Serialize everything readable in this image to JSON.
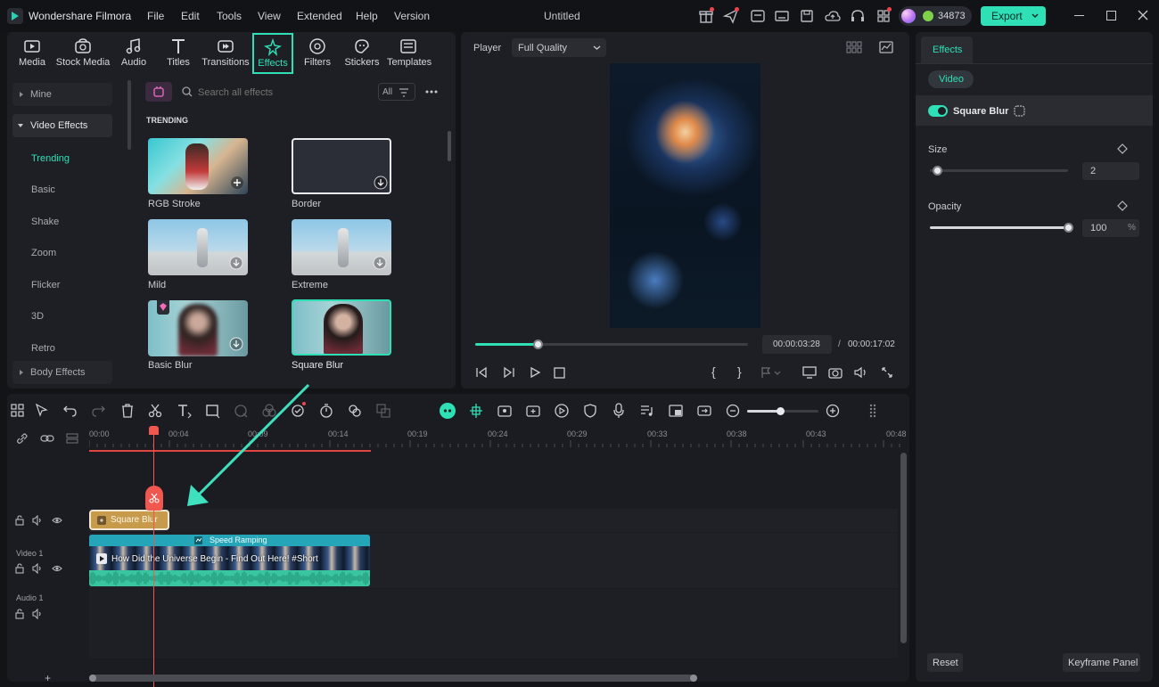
{
  "app": {
    "name": "Wondershare Filmora",
    "menu": [
      "File",
      "Edit",
      "Tools",
      "View",
      "Extended",
      "Help",
      "Version"
    ],
    "doc_title": "Untitled",
    "credits": "34873",
    "export_label": "Export"
  },
  "toolbar": {
    "tabs": [
      {
        "label": "Media",
        "icon": "media-icon"
      },
      {
        "label": "Stock Media",
        "icon": "stock-media-icon"
      },
      {
        "label": "Audio",
        "icon": "audio-icon"
      },
      {
        "label": "Titles",
        "icon": "titles-icon"
      },
      {
        "label": "Transitions",
        "icon": "transitions-icon"
      },
      {
        "label": "Effects",
        "icon": "effects-icon"
      },
      {
        "label": "Filters",
        "icon": "filters-icon"
      },
      {
        "label": "Stickers",
        "icon": "stickers-icon"
      },
      {
        "label": "Templates",
        "icon": "templates-icon"
      }
    ],
    "active_tab": "Effects"
  },
  "effects_sidebar": {
    "mine": "Mine",
    "video_effects": "Video Effects",
    "items": [
      "Trending",
      "Basic",
      "Shake",
      "Zoom",
      "Flicker",
      "3D",
      "Retro"
    ],
    "body_effects": "Body Effects"
  },
  "effects_browser": {
    "search_placeholder": "Search all effects",
    "filter_label": "All",
    "section": "TRENDING",
    "items": [
      "RGB Stroke",
      "Border",
      "Mild",
      "Extreme",
      "Basic Blur",
      "Square Blur"
    ]
  },
  "player": {
    "label": "Player",
    "quality": "Full Quality",
    "current_time": "00:00:03:28",
    "separator": "/",
    "total_time": "00:00:17:02",
    "progress": 0.23
  },
  "right_panel": {
    "tab": "Effects",
    "subtab": "Video",
    "effect_name": "Square Blur",
    "size_label": "Size",
    "size_value": "2",
    "opacity_label": "Opacity",
    "opacity_value": "100",
    "opacity_unit": "%",
    "reset_label": "Reset",
    "keyframe_label": "Keyframe Panel",
    "size_fraction": 0.05,
    "opacity_fraction": 1.0
  },
  "timeline": {
    "ruler": [
      "00:00",
      "00:04",
      "00:09",
      "00:14",
      "00:19",
      "00:24",
      "00:29",
      "00:33",
      "00:38",
      "00:43",
      "00:48"
    ],
    "effect_clip": "Square Blur",
    "speed_label": "Speed Ramping",
    "video_clip_title": "How Did the Universe Begin - Find Out Here! #Short",
    "video_track_label": "Video 1",
    "audio_track_label": "Audio 1"
  }
}
